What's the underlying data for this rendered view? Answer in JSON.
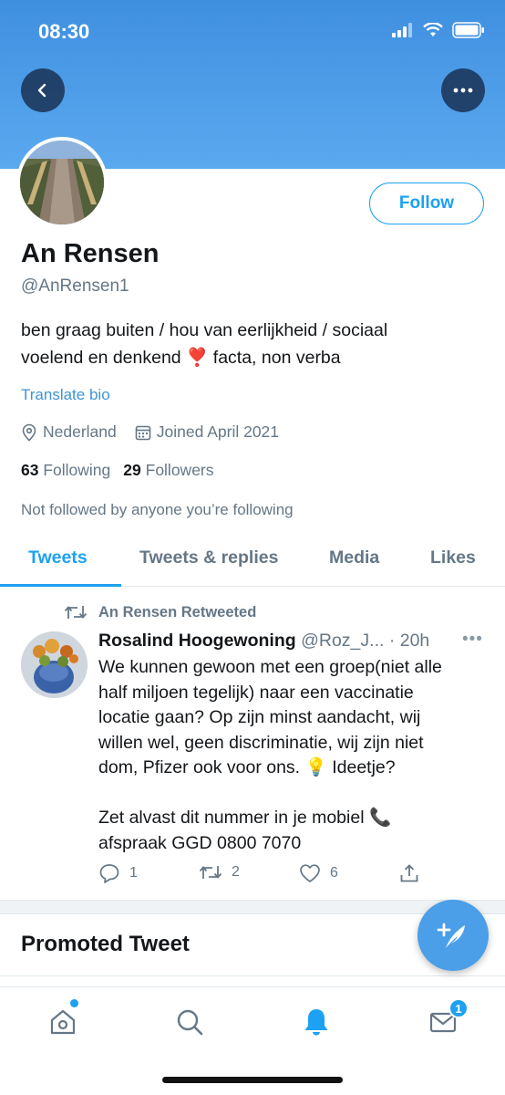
{
  "status_bar": {
    "time": "08:30"
  },
  "profile": {
    "name": "An Rensen",
    "handle": "@AnRensen1",
    "bio_line1": "ben graag buiten / hou van eerlijkheid / sociaal",
    "bio_line2": "voelend en denkend",
    "bio_emoji": "❣️",
    "bio_line2_end": "facta, non verba",
    "translate_label": "Translate bio",
    "location": "Nederland",
    "joined": "Joined April 2021",
    "following_count": "63",
    "following_label": "Following",
    "followers_count": "29",
    "followers_label": "Followers",
    "not_followed_text": "Not followed by anyone you’re following",
    "follow_button": "Follow"
  },
  "tabs": [
    {
      "label": "Tweets",
      "active": true
    },
    {
      "label": "Tweets & replies",
      "active": false
    },
    {
      "label": "Media",
      "active": false
    },
    {
      "label": "Likes",
      "active": false
    }
  ],
  "tweet": {
    "retweeted_by": "An Rensen Retweeted",
    "author": "Rosalind Hoogewoning",
    "author_handle": "@Roz_J...",
    "time": "· 20h",
    "text_line1": "We kunnen gewoon met een groep(niet alle",
    "text_line2": "half miljoen tegelijk) naar een vaccinatie",
    "text_line3": "locatie gaan? Op zijn minst aandacht, wij",
    "text_line4": "willen wel, geen discriminatie, wij zijn niet",
    "text_line5": "dom, Pfizer ook voor ons. 💡 Ideetje?",
    "text_line6": "Zet alvast dit nummer in je mobiel 📞",
    "text_line7": "afspraak GGD 0800 7070",
    "replies": "1",
    "retweets": "2",
    "likes": "6"
  },
  "promoted": {
    "title": "Promoted Tweet"
  },
  "tab_bar": {
    "messages_badge": "1"
  },
  "colors": {
    "accent": "#1da1f2",
    "header_top": "#3f8fe0",
    "header_bottom": "#5aa9ef"
  }
}
